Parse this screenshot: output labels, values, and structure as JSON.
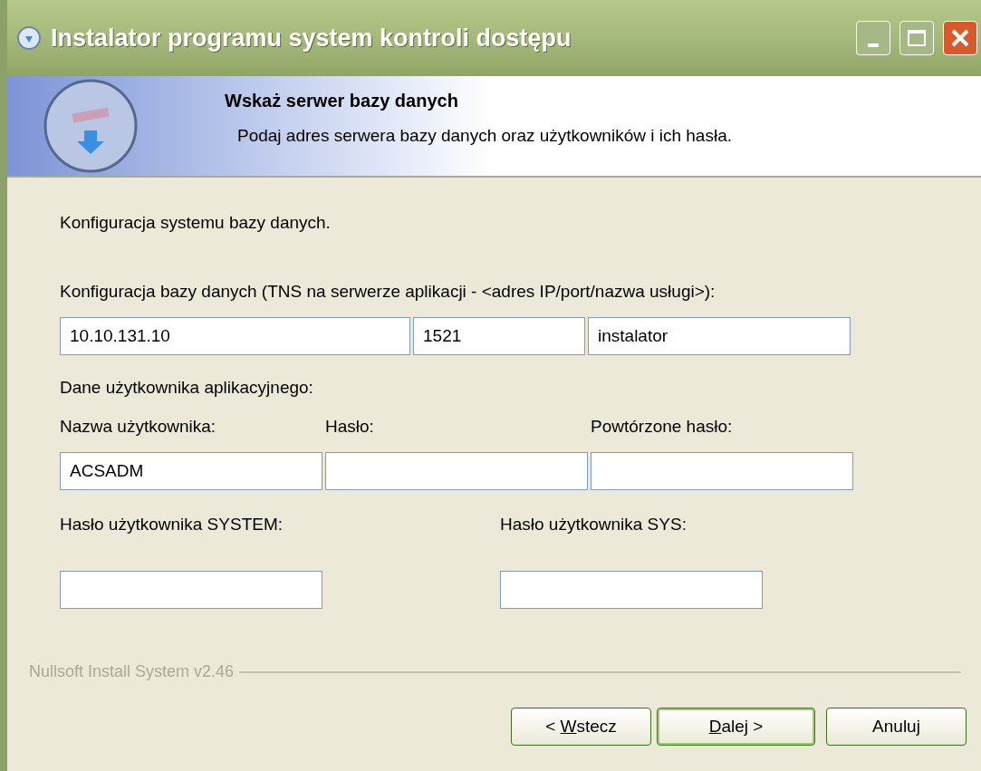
{
  "window": {
    "title": "Instalator programu system kontroli dostępu"
  },
  "header": {
    "title": "Wskaż serwer bazy danych",
    "subtitle": "Podaj adres serwera bazy danych oraz użytkowników i ich hasła."
  },
  "intro": "Konfiguracja systemu bazy danych.",
  "tns": {
    "label": "Konfiguracja bazy danych (TNS na serwerze aplikacji - <adres IP/port/nazwa usługi>):",
    "fields": [
      {
        "value": "10.10.131.10"
      },
      {
        "value": "1521"
      },
      {
        "value": "instalator"
      }
    ]
  },
  "app_user": {
    "label": "Dane użytkownika aplikacyjnego:",
    "fields": [
      {
        "label": "Nazwa użytkownika:",
        "value": "ACSADM"
      },
      {
        "label": "Hasło:"
      },
      {
        "label": "Powtórzone hasło:"
      }
    ]
  },
  "admin": {
    "fields": [
      {
        "label": "Hasło użytkownika SYSTEM:"
      },
      {
        "label": "Hasło użytkownika SYS:"
      }
    ]
  },
  "branding": "Nullsoft Install System v2.46",
  "buttons": [
    {
      "label_before": "< ",
      "accesskey": "W",
      "label_after": "stecz",
      "default": false
    },
    {
      "accesskey": "D",
      "label_after": "alej >",
      "default": true
    },
    {
      "label_after": "Anuluj",
      "default": false
    }
  ]
}
